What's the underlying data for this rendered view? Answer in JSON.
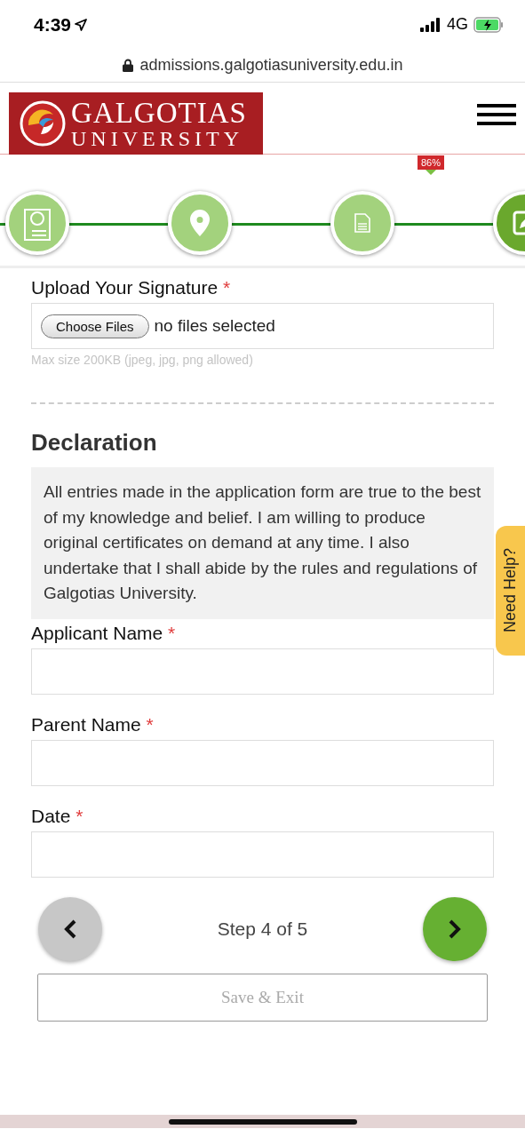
{
  "status_bar": {
    "time": "4:39",
    "network": "4G"
  },
  "address_bar": {
    "url": "admissions.galgotiasuniversity.edu.in"
  },
  "header": {
    "logo_line1": "GALGOTIAS",
    "logo_line2": "UNIVERSITY"
  },
  "progress": {
    "badge": "86%",
    "steps": [
      {
        "selected": false
      },
      {
        "selected": false
      },
      {
        "selected": false
      },
      {
        "selected": true
      }
    ]
  },
  "signature": {
    "label": "Upload Your Signature",
    "required_mark": "*",
    "button": "Choose Files",
    "status": "no files selected",
    "hint": "Max size 200KB (jpeg, jpg, png allowed)"
  },
  "declaration": {
    "title": "Declaration",
    "text": "All entries made in the application form are true to the best of my knowledge and belief. I am willing to produce original certificates on demand at any time. I also undertake that I shall abide by the rules and regulations of Galgotias University."
  },
  "fields": [
    {
      "label": "Applicant Name",
      "required_mark": "*"
    },
    {
      "label": "Parent Name",
      "required_mark": "*"
    },
    {
      "label": "Date",
      "required_mark": "*"
    }
  ],
  "navigation": {
    "step_text": "Step 4 of 5",
    "save_button": "Save & Exit"
  },
  "help_tab": {
    "label": "Need Help?"
  }
}
